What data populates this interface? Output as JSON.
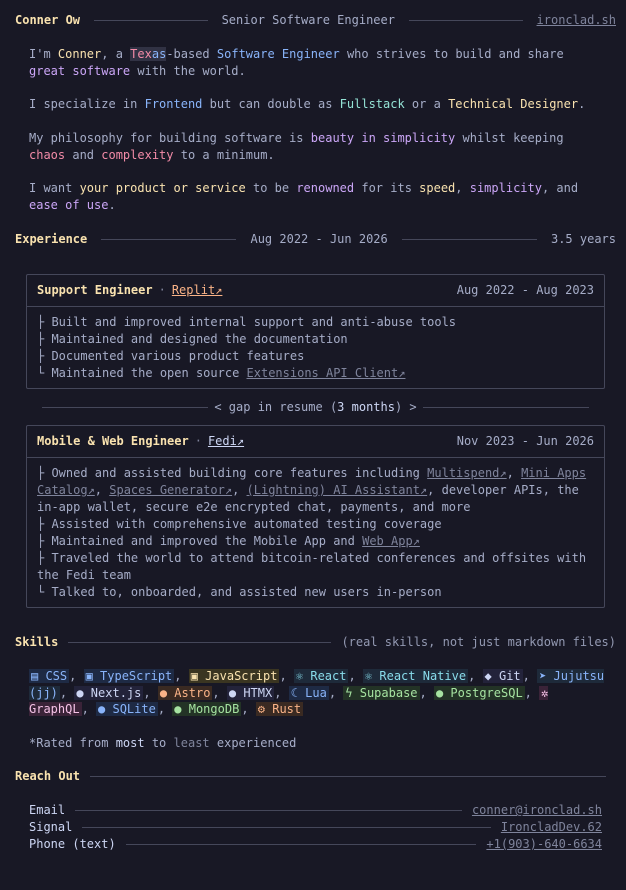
{
  "header": {
    "name": "Conner Ow",
    "title": "Senior Software Engineer",
    "site": "ironclad.sh"
  },
  "intro": {
    "p1": [
      "I'm ",
      "Conner",
      ", a ",
      "Tex",
      "as",
      "-based ",
      "Software Engineer",
      " who strives to build and share ",
      "great software",
      " with the world."
    ],
    "p2": [
      "I specialize in ",
      "Frontend",
      " but can double as ",
      "Fullstack",
      " or a ",
      "Technical Designer",
      "."
    ],
    "p3": [
      "My philosophy for building software is ",
      "beauty in simplicity",
      " whilst keeping ",
      "chaos",
      " and ",
      "complexity",
      " to a minimum."
    ],
    "p4": [
      "I want ",
      "your product or service",
      " to be ",
      "renowned",
      " for its ",
      "speed",
      ", ",
      "simplicity",
      ", and ",
      "ease of use",
      "."
    ]
  },
  "experience": {
    "heading": "Experience",
    "range": "Aug 2022 - Jun 2026",
    "total": "3.5 years",
    "jobs": [
      {
        "role": "Support Engineer",
        "company": "Replit↗",
        "dates": "Aug 2022 - Aug 2023",
        "items": [
          "├ Built and improved internal support and anti-abuse tools",
          "├ Maintained and designed the documentation",
          "├ Documented various product features",
          "└ Maintained the open source "
        ],
        "last_link": "Extensions API Client↗"
      },
      {
        "role": "Mobile & Web Engineer",
        "company": "Fedi↗",
        "dates": "Nov 2023 - Jun 2026",
        "line1_a": "├ Owned and assisted building core features including ",
        "link_multispend": "Multispend↗",
        "sep": ", ",
        "link_miniapps": "Mini Apps Catalog↗",
        "link_spaces": "Spaces Generator↗",
        "link_ai": "(Lightning) AI Assistant↗",
        "line1_b": ", developer APIs, the in-app wallet, secure e2e encrypted chat, payments, and more",
        "line2": "├ Assisted with comprehensive automated testing coverage",
        "line3_a": "├ Maintained and improved the Mobile App and ",
        "link_webapp": "Web App↗",
        "line4": "├ Traveled the world to attend bitcoin-related conferences and offsites with the Fedi team",
        "line5": "└ Talked to, onboarded, and assisted new users in-person"
      }
    ],
    "gap": {
      "prefix": "< gap in resume (",
      "amount": "3 months",
      "suffix": ") >"
    }
  },
  "skills": {
    "heading": "Skills",
    "note": "(real skills, not just markdown files)",
    "list": [
      "▤ CSS",
      "▣ TypeScript",
      "▣ JavaScript",
      "⚛ React",
      "⚛ React Native",
      "◆ Git",
      "➤ Jujutsu (jj)",
      "● Next.js",
      "● Astro",
      "● HTMX",
      "☾ Lua",
      "ϟ Supabase",
      "● PostgreSQL",
      "✲ GraphQL",
      "● SQLite",
      "● MongoDB",
      "⚙ Rust"
    ],
    "footnote": [
      "*Rated from ",
      "most",
      " to ",
      "least",
      " experienced"
    ]
  },
  "contact": {
    "heading": "Reach Out",
    "rows": [
      {
        "label": "Email",
        "value": "conner@ironclad.sh"
      },
      {
        "label": "Signal",
        "value": "IroncladDev.62"
      },
      {
        "label": "Phone (text)",
        "value": "+1(903)-640-6634"
      }
    ]
  },
  "colors": {
    "background": "#181825",
    "yellow": "#f9e2af",
    "purple": "#cba6f7",
    "blue": "#89b4fa",
    "red": "#f38ba8",
    "orange": "#fab387"
  }
}
